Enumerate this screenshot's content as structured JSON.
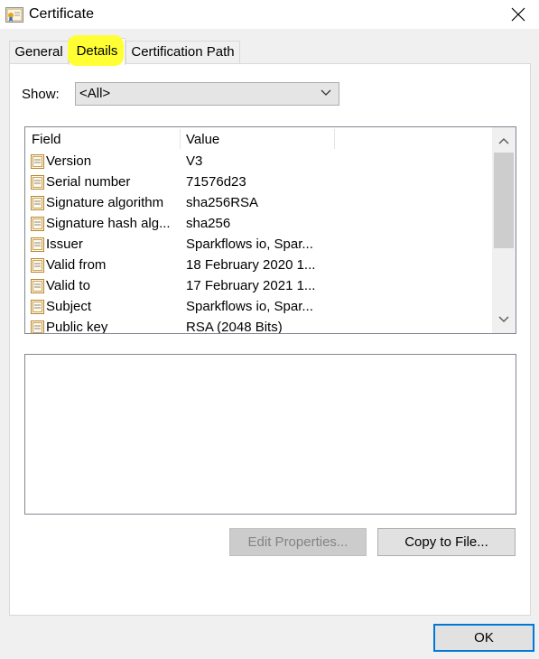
{
  "window": {
    "title": "Certificate",
    "icon": "certificate-icon",
    "close_icon": "close-icon"
  },
  "tabs": [
    {
      "label": "General",
      "selected": false
    },
    {
      "label": "Details",
      "selected": true,
      "highlight_color": "#ffff33"
    },
    {
      "label": "Certification Path",
      "selected": false
    }
  ],
  "show": {
    "label": "Show:",
    "value": "<All>"
  },
  "list": {
    "columns": [
      "Field",
      "Value"
    ],
    "rows": [
      {
        "field": "Version",
        "value": "V3"
      },
      {
        "field": "Serial number",
        "value": "71576d23"
      },
      {
        "field": "Signature algorithm",
        "value": "sha256RSA"
      },
      {
        "field": "Signature hash alg...",
        "value": "sha256"
      },
      {
        "field": "Issuer",
        "value": "Sparkflows io, Spar..."
      },
      {
        "field": "Valid from",
        "value": "18 February 2020 1..."
      },
      {
        "field": "Valid to",
        "value": "17 February 2021 1..."
      },
      {
        "field": "Subject",
        "value": "Sparkflows io, Spar..."
      },
      {
        "field": "Public key",
        "value": "RSA (2048 Bits)"
      }
    ]
  },
  "buttons": {
    "edit_properties": "Edit Properties...",
    "copy_to_file": "Copy to File...",
    "ok": "OK"
  },
  "colors": {
    "focus_border": "#0078d7",
    "tab_highlight": "#ffff33"
  }
}
